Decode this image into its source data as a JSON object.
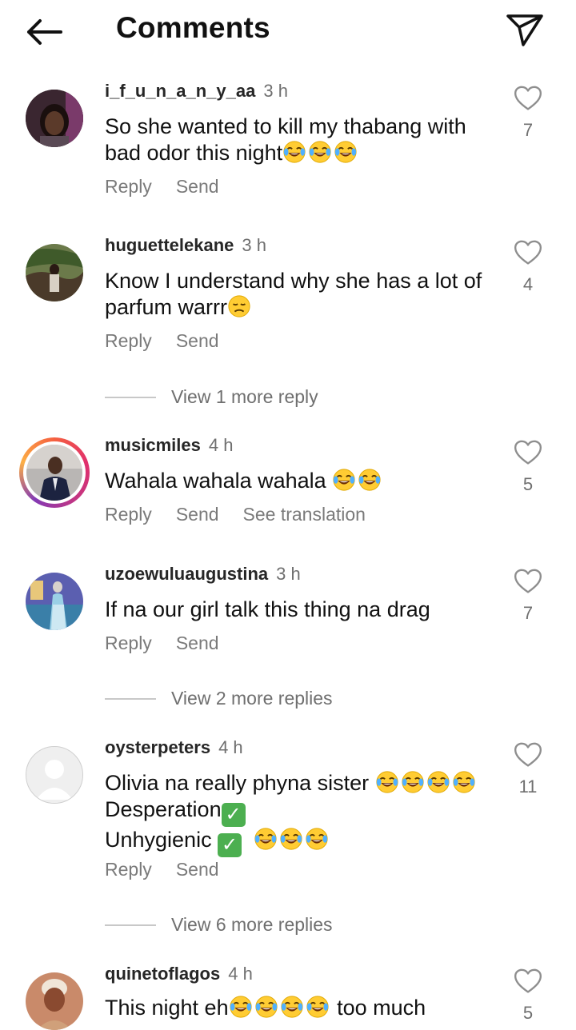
{
  "header": {
    "title": "Comments",
    "back_icon": "arrow-left-icon",
    "send_icon": "paper-plane-icon"
  },
  "emoji": {
    "laugh": "face-with-tears-of-joy",
    "sad": "disappointed-face",
    "check": "check-mark-button"
  },
  "comments": [
    {
      "username": "i_f_u_n_a_n_y_aa",
      "time": "3 h",
      "text_lines": [
        "So she wanted to kill my thabang with",
        "bad odor this night"
      ],
      "likes": "7",
      "actions": [
        "Reply",
        "Send"
      ]
    },
    {
      "username": "huguettelekane",
      "time": "3 h",
      "text_lines": [
        "Know I understand why she has a lot of",
        "parfum warrr"
      ],
      "likes": "4",
      "actions": [
        "Reply",
        "Send"
      ],
      "view_more": "View 1 more reply"
    },
    {
      "username": "musicmiles",
      "time": "4 h",
      "text_lines": [
        "Wahala wahala wahala "
      ],
      "likes": "5",
      "actions": [
        "Reply",
        "Send",
        "See translation"
      ]
    },
    {
      "username": "uzoewuluaugustina",
      "time": "3 h",
      "text_lines": [
        "If na our girl talk this thing na drag"
      ],
      "likes": "7",
      "actions": [
        "Reply",
        "Send"
      ],
      "view_more": "View 2 more replies"
    },
    {
      "username": "oysterpeters",
      "time": "4 h",
      "text_lines": [
        "Olivia na really phyna sister ",
        "Desperation",
        "Unhygienic "
      ],
      "likes": "11",
      "actions": [
        "Reply",
        "Send"
      ],
      "view_more": "View 6 more replies"
    },
    {
      "username": "quinetoflagos",
      "time": "4 h",
      "text_lines": [
        "This night eh",
        " too much"
      ],
      "likes": "5"
    }
  ]
}
